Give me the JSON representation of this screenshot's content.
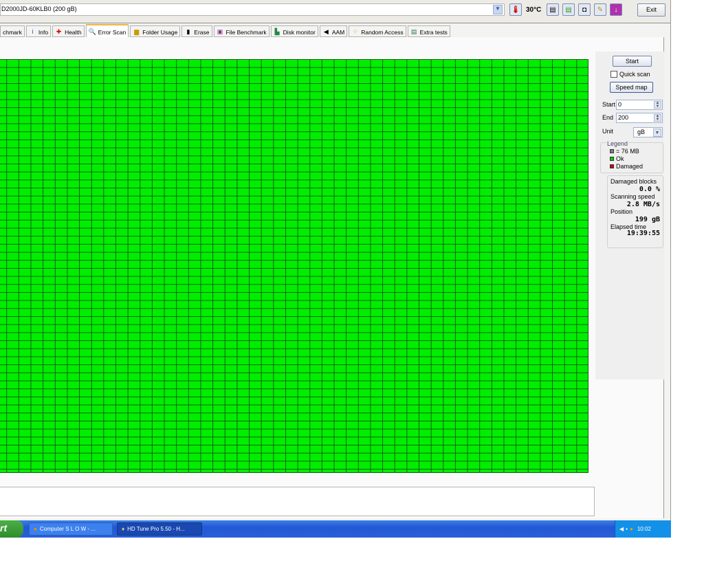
{
  "drive": {
    "selected": "D2000JD-60KLB0 (200 gB)"
  },
  "temperature": "30°C",
  "toolbar": {
    "exit_label": "Exit",
    "icons": [
      "copy-info-icon",
      "copy-all-icon",
      "screenshot-camera-icon",
      "options-icon",
      "save-download-icon"
    ]
  },
  "tabs": [
    {
      "label": "chmark",
      "icon": "benchmark-icon"
    },
    {
      "label": "Info",
      "icon": "info-icon"
    },
    {
      "label": "Health",
      "icon": "health-cross-icon"
    },
    {
      "label": "Error Scan",
      "icon": "magnifier-icon",
      "active": true
    },
    {
      "label": "Folder Usage",
      "icon": "folder-icon"
    },
    {
      "label": "Erase",
      "icon": "trash-icon"
    },
    {
      "label": "File Benchmark",
      "icon": "file-benchmark-icon"
    },
    {
      "label": "Disk monitor",
      "icon": "disk-monitor-icon"
    },
    {
      "label": "AAM",
      "icon": "speaker-icon"
    },
    {
      "label": "Random Access",
      "icon": "random-access-icon"
    },
    {
      "label": "Extra tests",
      "icon": "extra-tests-icon"
    }
  ],
  "scan_grid": {
    "ok_color": "#00ee00",
    "damaged_blocks": 0
  },
  "side": {
    "start_button": "Start",
    "quick_scan_label": "Quick scan",
    "quick_scan_checked": false,
    "speed_map_button": "Speed map",
    "start_label": "Start",
    "start_value": "0",
    "end_label": "End",
    "end_value": "200",
    "unit_label": "Unit",
    "unit_value": "gB",
    "legend": {
      "title": "Legend",
      "block": "= 76 MB",
      "ok": "Ok",
      "damaged": "Damaged",
      "colors": {
        "block": "#808080",
        "ok": "#00cc00",
        "damaged": "#cc0000"
      }
    },
    "stats": {
      "damaged_label": "Damaged blocks",
      "damaged_value": "0.0 %",
      "speed_label": "Scanning speed",
      "speed_value": "2.8 MB/s",
      "position_label": "Position",
      "position_value": "199 gB",
      "elapsed_label": "Elapsed time",
      "elapsed_value": "19:39:55"
    }
  },
  "taskbar": {
    "start": "rt",
    "tasks": [
      "Computer S L O W - ...",
      "HD Tune Pro 5.50 - H..."
    ],
    "clock": "10:02"
  }
}
